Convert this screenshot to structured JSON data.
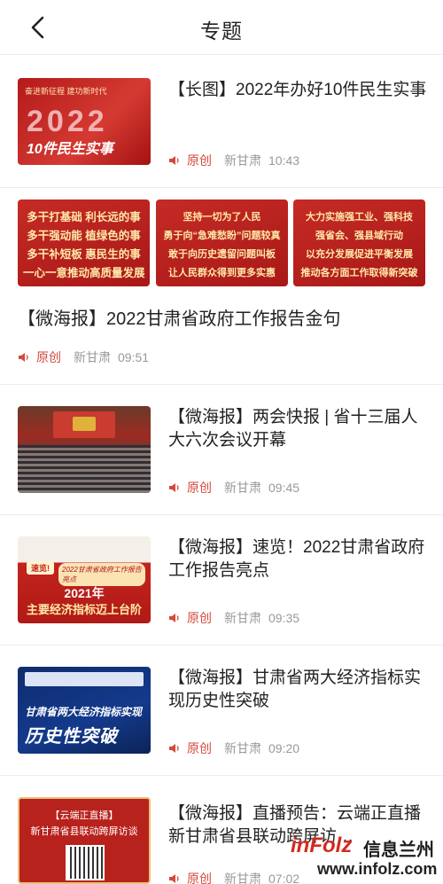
{
  "header": {
    "title": "专题"
  },
  "items": [
    {
      "title": "【长图】2022年办好10件民生实事",
      "orig": "原创",
      "source": "新甘肃",
      "time": "10:43",
      "thumb": {
        "caption": "奋进新征程 建功新时代",
        "year": "2022",
        "sub": "10件民生实事"
      }
    },
    {
      "title": "【微海报】2022甘肃省政府工作报告金句",
      "orig": "原创",
      "source": "新甘肃",
      "time": "09:51",
      "posters": [
        [
          "多干打基础 利长远的事",
          "多干强动能 植绿色的事",
          "多干补短板 惠民生的事",
          "一心一意推动高质量发展"
        ],
        [
          "坚持一切为了人民",
          "勇于向“急难愁盼”问题较真",
          "敢于向历史遗留问题叫板",
          "让人民群众得到更多实惠"
        ],
        [
          "大力实施强工业、强科技",
          "强省会、强县域行动",
          "以充分发展促进平衡发展",
          "推动各方面工作取得新突破"
        ]
      ]
    },
    {
      "title": "【微海报】两会快报 | 省十三届人大六次会议开幕",
      "orig": "原创",
      "source": "新甘肃",
      "time": "09:45"
    },
    {
      "title": "【微海报】速览！2022甘肃省政府工作报告亮点",
      "orig": "原创",
      "source": "新甘肃",
      "time": "09:35",
      "thumb": {
        "badge": "速览!",
        "strip": "2022甘肃省政府工作报告亮点",
        "big1": "2021年",
        "big2": "主要经济指标迈上台阶"
      }
    },
    {
      "title": "【微海报】甘肃省两大经济指标实现历史性突破",
      "orig": "原创",
      "source": "新甘肃",
      "time": "09:20",
      "thumb": {
        "l1": "甘肃省两大经济指标实现",
        "l2": "历史性突破"
      }
    },
    {
      "title": "【微海报】直播预告：云端正直播 新甘肃省县联动跨屏访…",
      "orig": "原创",
      "source": "新甘肃",
      "time": "07:02",
      "thumb": {
        "l1": "【云端正直播】",
        "l2": "新甘肃省县联动跨屏访谈"
      }
    }
  ],
  "watermark": {
    "logo": "inFolz",
    "text": "信息兰州",
    "url": "www.infolz.com"
  },
  "colors": {
    "accent": "#d34a3b",
    "brand_red": "#c62b25"
  }
}
